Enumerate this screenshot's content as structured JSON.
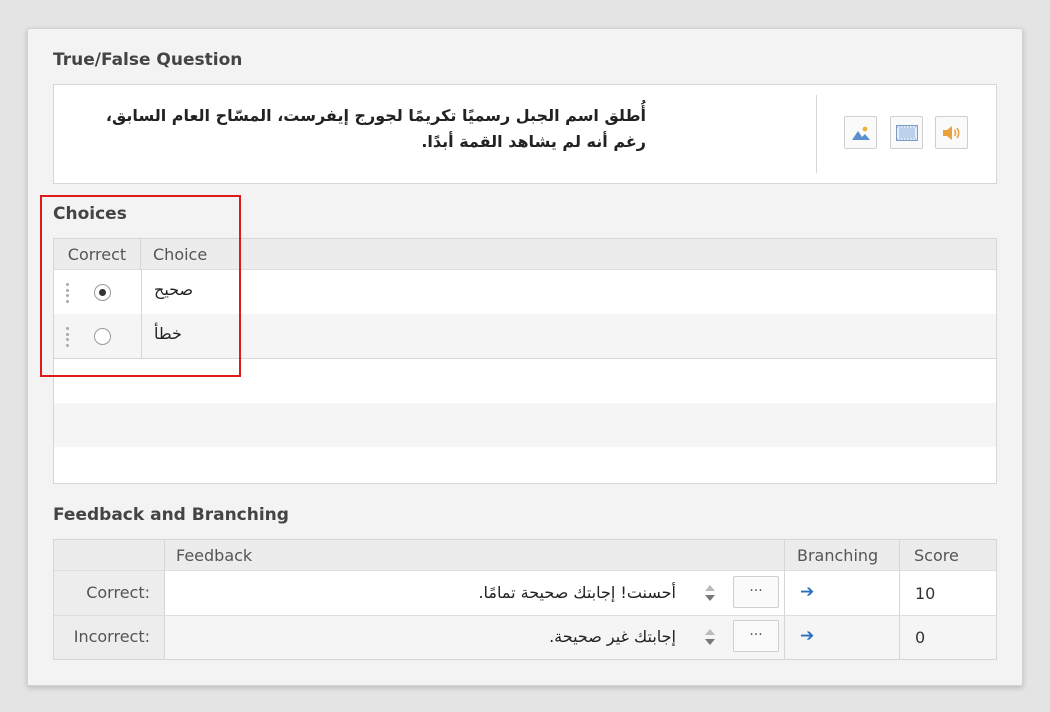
{
  "question": {
    "section_title": "True/False Question",
    "text": "أُطلق اسم الجبل رسميًا تكريمًا لجورج إيفرست، المسّاح العام السابق، رغم أنه لم يشاهد القمة أبدًا."
  },
  "choices": {
    "section_title": "Choices",
    "col_correct": "Correct",
    "col_choice": "Choice",
    "items": [
      {
        "label": "صحيح",
        "correct": true
      },
      {
        "label": "خطأ",
        "correct": false
      }
    ]
  },
  "feedback": {
    "section_title": "Feedback and Branching",
    "col_feedback": "Feedback",
    "col_branching": "Branching",
    "col_score": "Score",
    "rows": [
      {
        "label": "Correct:",
        "text": "أحسنت! إجابتك صحيحة تمامًا.",
        "button": "···",
        "score": "10"
      },
      {
        "label": "Incorrect:",
        "text": "إجابتك غير صحيحة.",
        "button": "···",
        "score": "0"
      }
    ]
  },
  "colors": {
    "highlight": "#e01919",
    "accent": "#2b6fc5"
  }
}
